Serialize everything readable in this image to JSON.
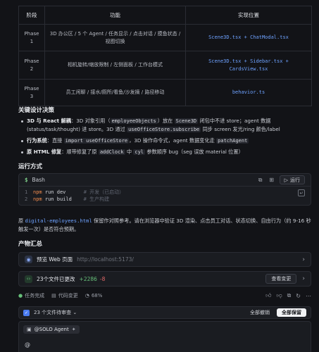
{
  "table": {
    "headers": [
      "阶段",
      "功能",
      "实现位置"
    ],
    "rows": [
      {
        "phase": "Phase 1",
        "feature": "3D 办公区 / 5 个 Agent / 任务显示 / 点击对话 / 摸鱼状态 / 视图切换",
        "location": "Scene3D.tsx + ChatModal.tsx"
      },
      {
        "phase": "Phase 2",
        "feature": "相机旋转/缩放限制 / 左侧面板 / 工作台模式",
        "location": "Scene3D.tsx + Sidebar.tsx + CardsView.tsx"
      },
      {
        "phase": "Phase 3",
        "feature": "员工闲聊 / 接水/厕所/看鱼/沙发摘 / 路径移动",
        "location": "behavior.ts"
      }
    ]
  },
  "design": {
    "heading": "关键设计决策",
    "b1": {
      "label": "3D 与 React 解耦",
      "t1": "：3D 对象引用（",
      "c1": "employeeObjects",
      "t2": "）放在",
      "c2": "Scene3D",
      "t3": "闭包中不进 store；agent 数据(status/task/thought) 进 store。3D 通过",
      "c3": "useOfficeStore.subscribe",
      "t4": "同步 screen 发光/ring 颜色/label"
    },
    "b2": {
      "label": "行为系统",
      "t1": "：直接",
      "c1": "import useOfficeStore",
      "t2": "，3D 操作命令式，agent 数据变化走",
      "c2": "patchAgent"
    },
    "b3": {
      "label": "原 HTML 修复",
      "t1": "：顺带修复了原",
      "c1": "addClock",
      "t2": "中",
      "c2": "cyl",
      "t3": "参数顺序 bug（seg 误放 material 位置）"
    }
  },
  "run": {
    "heading": "运行方式",
    "lang": "Bash",
    "run_label": "运行",
    "lines": [
      {
        "n": "1",
        "kw": "npm",
        "cmd": "run dev",
        "comment": "# 开发（已启动）"
      },
      {
        "n": "2",
        "kw": "npm",
        "cmd": "run build",
        "comment": "# 生产构建"
      }
    ]
  },
  "note": {
    "t1": "原",
    "file": "digital-employees.html",
    "t2": "保留作对照参考。请在浏览器中验证 3D 渲染、点击员工对话、状态切换、自由行为（约 9-16 秒触发一次）是否符合预期。"
  },
  "artifacts": {
    "heading": "产物汇总",
    "preview_label": "预览 Web 页面",
    "preview_url": "http://localhost:5173/",
    "files_label": "23个文件已更改",
    "added": "+2286",
    "removed": "-8",
    "view_changes": "查看变更"
  },
  "status": {
    "task_done": "任务完成",
    "code_changes": "代码变更",
    "progress": "68%"
  },
  "review": {
    "pending": "23 个文件待审查",
    "reject_all": "全部撤销",
    "keep_all": "全部保留"
  },
  "composer": {
    "agent": "@SOLO Agent",
    "prompt": "@"
  },
  "colors": {
    "background": "#121317",
    "link": "#6ea2ff",
    "added": "#67c07a",
    "removed": "#e46a6a",
    "checkbox": "#4b7cf0"
  }
}
